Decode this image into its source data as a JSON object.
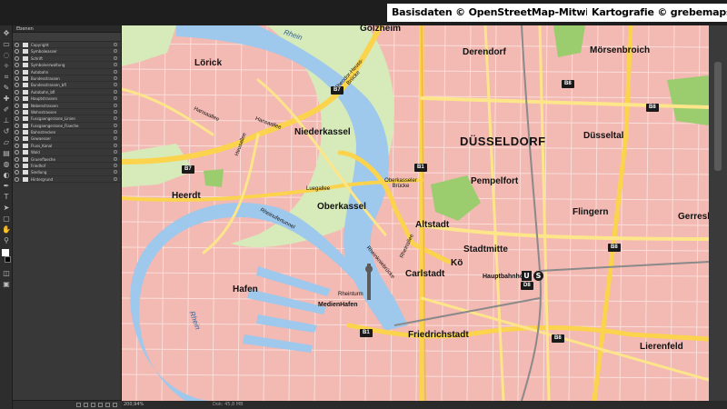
{
  "credits": {
    "osm": "Basisdaten © OpenStreetMap-Mitwirkende",
    "carto": "Kartografie © grebemaps.de"
  },
  "layers_panel": {
    "title": "Ebenen",
    "layers": [
      "Copyright",
      "Symbolwasser",
      "Schrift",
      "Symbolverwaltung",
      "Autobahn",
      "Bundesstrassen",
      "Bundesstrassen_bfl",
      "Autobahn_bfl",
      "Hauptstrassen",
      "Nebenstrassen",
      "Wohnstrassen",
      "Fussgaengerzone_Linien",
      "Fussgaengerzone_Flaeche",
      "Bahnstrecken",
      "Gewaesser",
      "Fluss_Kanal",
      "Wald",
      "Gruenflaeche",
      "Friedhof",
      "Siedlung",
      "Hintergrund"
    ]
  },
  "status": {
    "zoom": "200,94%",
    "doc": "Dok: 45,8 MB"
  },
  "map": {
    "districts": {
      "golzheim": "Golzheim",
      "derendorf": "Derendorf",
      "moersenbroich": "Mörsenbroich",
      "loerick": "Lörick",
      "niederkassel": "Niederkassel",
      "duesseltal": "Düsseltal",
      "duesseldorf": "DÜSSELDORF",
      "pempelfort": "Pempelfort",
      "heerdt": "Heerdt",
      "oberkassel": "Oberkassel",
      "flingern": "Flingern",
      "gerresheim": "Gerreshe",
      "altstadt": "Altstadt",
      "stadtmitte": "Stadtmitte",
      "koe": "Kö",
      "carlstadt": "Carlstadt",
      "hbf": "Hauptbahnhof",
      "hafen": "Hafen",
      "medienhafen": "MedienHafen",
      "friedrichstadt": "Friedrichstadt",
      "lierenfeld": "Lierenfeld"
    },
    "streets": {
      "hansaallee": "Hansaallee",
      "hansaallee2": "Hansaallee",
      "heusallee": "Heusallee",
      "luegallee": "Luegallee",
      "rheinufertunnel": "Rheinufertunnel",
      "rheinallee": "Rheinallee",
      "rheinkniebruecke": "Rheinkniebrücke",
      "theodor_heuss": "Theodor-Heuss-Brücke",
      "oberkasseler": "Oberkasseler Brücke",
      "rheinturm": "Rheinturm"
    },
    "water": {
      "rhein_top": "Rhein",
      "rhein_left": "Rhein"
    },
    "shields": {
      "b7_top": "B7",
      "b7_left": "B7",
      "b1_mid": "B1",
      "b1_low": "B1",
      "b8_top": "B8",
      "b8_mid": "B8",
      "b8_low": "B8",
      "b8_right": "B8",
      "d8": "D8"
    },
    "stations": {
      "u": "U",
      "s": "S"
    },
    "colors": {
      "settlement": "#f3b9b3",
      "water": "#9ec8ec",
      "green": "#d6ebb9",
      "forest": "#9bcc6e",
      "motorway": "#fbd34d",
      "primary": "#fde58a"
    }
  }
}
